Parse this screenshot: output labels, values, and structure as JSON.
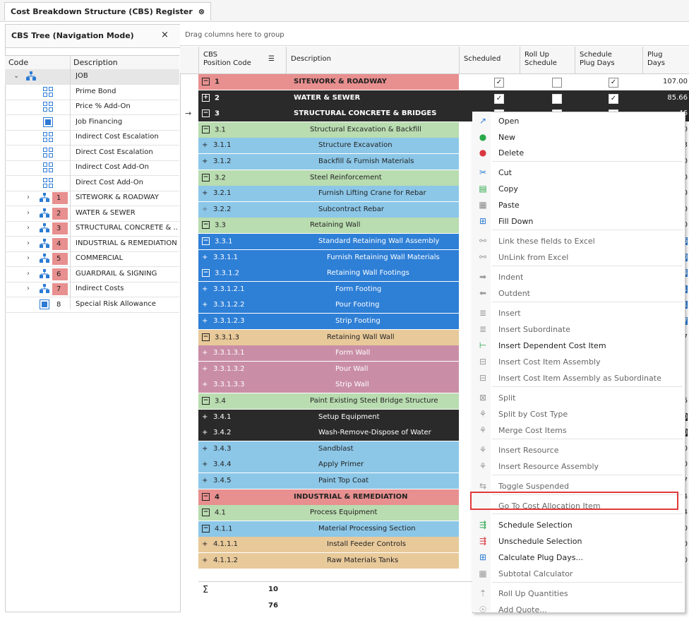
{
  "tab": {
    "title": "Cost Breakdown Structure (CBS) Register",
    "close": "⊗"
  },
  "left": {
    "title": "CBS Tree (Navigation Mode)",
    "close": "×",
    "col_code": "Code",
    "col_desc": "Description",
    "items": [
      {
        "num": "",
        "desc": "JOB"
      },
      {
        "num": "",
        "desc": "Prime Bond"
      },
      {
        "num": "",
        "desc": "Price % Add-On"
      },
      {
        "num": "",
        "desc": "Job Financing"
      },
      {
        "num": "",
        "desc": "Indirect Cost Escalation"
      },
      {
        "num": "",
        "desc": "Direct Cost Escalation"
      },
      {
        "num": "",
        "desc": "Indirect Cost Add-On"
      },
      {
        "num": "",
        "desc": "Direct Cost Add-On"
      },
      {
        "num": "1",
        "desc": "SITEWORK & ROADWAY"
      },
      {
        "num": "2",
        "desc": "WATER & SEWER"
      },
      {
        "num": "3",
        "desc": "STRUCTURAL CONCRETE & ..."
      },
      {
        "num": "4",
        "desc": "INDUSTRIAL & REMEDIATION"
      },
      {
        "num": "5",
        "desc": "COMMERCIAL"
      },
      {
        "num": "6",
        "desc": "GUARDRAIL & SIGNING"
      },
      {
        "num": "7",
        "desc": "Indirect Costs"
      },
      {
        "num": "8",
        "desc": "Special Risk Allowance"
      }
    ]
  },
  "grid": {
    "group_hint": "Drag columns here to group",
    "headers": {
      "code": "CBS\nPosition Code",
      "desc": "Description",
      "scheduled": "Scheduled",
      "rollup": "Roll Up\nSchedule",
      "plugdays": "Schedule\nPlug Days",
      "plug": "Plug\nDays"
    },
    "rows": [
      {
        "code": "1",
        "desc": "SITEWORK & ROADWAY",
        "plug": "107.00"
      },
      {
        "code": "2",
        "desc": "WATER & SEWER",
        "plug": "85.66"
      },
      {
        "code": "3",
        "desc": "STRUCTURAL CONCRETE & BRIDGES",
        "plug": "46"
      },
      {
        "code": "3.1",
        "desc": "Structural Excavation & Backfill",
        "plug": "00"
      },
      {
        "code": "3.1.1",
        "desc": "Structure Excavation",
        "plug": "33"
      },
      {
        "code": "3.1.2",
        "desc": "Backfill & Furnish Materials",
        "plug": "00"
      },
      {
        "code": "3.2",
        "desc": "Steel Reinforcement",
        "plug": "00"
      },
      {
        "code": "3.2.1",
        "desc": "Furnish Lifting Crane for Rebar",
        "plug": "00"
      },
      {
        "code": "3.2.2",
        "desc": "Subcontract Rebar",
        "plug": "00"
      },
      {
        "code": "3.3",
        "desc": "Retaining Wall",
        "plug": "30"
      },
      {
        "code": "3.3.1",
        "desc": "Standard Retaining Wall Assembly",
        "plug": "06"
      },
      {
        "code": "3.3.1.1",
        "desc": "Furnish Retaining Wall Materials",
        "plug": "20"
      },
      {
        "code": "3.3.1.2",
        "desc": "Retaining Wall Footings",
        "plug": "64"
      },
      {
        "code": "3.3.1.2.1",
        "desc": "Form Footing",
        "plug": "21"
      },
      {
        "code": "3.3.1.2.2",
        "desc": "Pour Footing",
        "plug": "01"
      },
      {
        "code": "3.3.1.2.3",
        "desc": "Strip Footing",
        "plug": "07"
      },
      {
        "code": "3.3.1.3",
        "desc": "Retaining Wall Wall",
        "plug": "17"
      },
      {
        "code": "3.3.1.3.1",
        "desc": "Form Wall",
        "plug": "00"
      },
      {
        "code": "3.3.1.3.2",
        "desc": "Pour Wall",
        "plug": "14"
      },
      {
        "code": "3.3.1.3.3",
        "desc": "Strip Wall",
        "plug": "86"
      },
      {
        "code": "3.4",
        "desc": "Paint Existing Steel Bridge Structure",
        "plug": "16"
      },
      {
        "code": "3.4.1",
        "desc": "Setup Equipment",
        "plug": "00"
      },
      {
        "code": "3.4.2",
        "desc": "Wash-Remove-Dispose of Water",
        "plug": "00"
      },
      {
        "code": "3.4.3",
        "desc": "Sandblast",
        "plug": "00"
      },
      {
        "code": "3.4.4",
        "desc": "Apply Primer",
        "plug": "50"
      },
      {
        "code": "3.4.5",
        "desc": "Paint Top Coat",
        "plug": "67"
      },
      {
        "code": "4",
        "desc": "INDUSTRIAL & REMEDIATION",
        "plug": "54"
      },
      {
        "code": "4.1",
        "desc": "Process Equipment",
        "plug": "54"
      },
      {
        "code": "4.1.1",
        "desc": "Material Processing Section",
        "plug": "00"
      },
      {
        "code": "4.1.1.1",
        "desc": "Install Feeder Controls",
        "plug": "00"
      },
      {
        "code": "4.1.1.2",
        "desc": "Raw Materials Tanks",
        "plug": "00"
      }
    ],
    "footer": {
      "sigma": "Σ",
      "count1": "10",
      "count2": "76"
    }
  },
  "menu": {
    "items": [
      "Open",
      "New",
      "Delete",
      "Cut",
      "Copy",
      "Paste",
      "Fill Down",
      "Link these fields to Excel",
      "UnLink from Excel",
      "Indent",
      "Outdent",
      "Insert",
      "Insert Subordinate",
      "Insert Dependent Cost Item",
      "Insert Cost Item Assembly",
      "Insert Cost Item Assembly as Subordinate",
      "Split",
      "Split by Cost Type",
      "Merge Cost Items",
      "Insert Resource",
      "Insert Resource Assembly",
      "Toggle Suspended",
      "Go To Cost Allocation Item",
      "Schedule Selection",
      "Unschedule Selection",
      "Calculate Plug Days...",
      "Subtotal Calculator",
      "Roll Up Quantities",
      "Add Quote..."
    ]
  },
  "colors": {
    "red_row": "#e88f8f",
    "dark_row": "#2a2a2a",
    "green_row": "#b9dcb0",
    "blue_row": "#8cc7e8",
    "deep_blue_row": "#2e7fd6",
    "tan_row": "#e8c99a",
    "mauve_row": "#c98ea6",
    "highlight": "#e0393a"
  }
}
